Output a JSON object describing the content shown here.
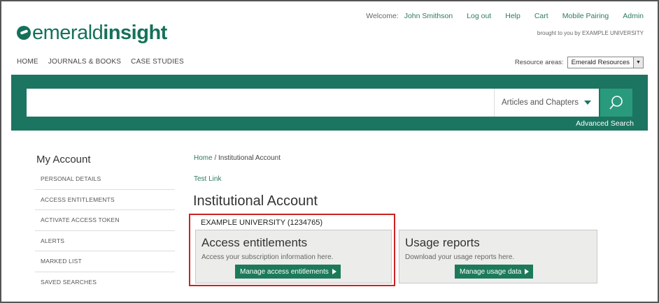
{
  "logo": {
    "part1": "emerald",
    "part2": "insight"
  },
  "topnav": {
    "welcome_label": "Welcome:",
    "user_name": "John Smithson",
    "logout": "Log out",
    "help": "Help",
    "cart": "Cart",
    "mobile_pairing": "Mobile Pairing",
    "admin": "Admin",
    "brought_by": "brought to you by EXAMPLE UNIVERSITY"
  },
  "mainnav": {
    "items": [
      "HOME",
      "JOURNALS & BOOKS",
      "CASE STUDIES"
    ]
  },
  "resources": {
    "label": "Resource areas:",
    "selected": "Emerald Resources"
  },
  "search": {
    "placeholder": "",
    "scope": "Articles and Chapters",
    "advanced": "Advanced Search"
  },
  "sidebar": {
    "title": "My Account",
    "items": [
      "PERSONAL DETAILS",
      "ACCESS ENTITLEMENTS",
      "ACTIVATE ACCESS TOKEN",
      "ALERTS",
      "MARKED LIST",
      "SAVED SEARCHES"
    ]
  },
  "breadcrumb": {
    "home": "Home",
    "separator": " / ",
    "current": "Institutional Account"
  },
  "test_link": "Test Link",
  "page_title": "Institutional Account",
  "institution": "EXAMPLE UNIVERSITY (1234765)",
  "cards": {
    "access": {
      "title": "Access entitlements",
      "desc": "Access your subscription information here.",
      "button": "Manage access entitlements"
    },
    "usage": {
      "title": "Usage reports",
      "desc": "Download your usage reports here.",
      "button": "Manage usage data"
    }
  },
  "colors": {
    "brand": "#1c7560",
    "highlight": "#cc2222"
  }
}
